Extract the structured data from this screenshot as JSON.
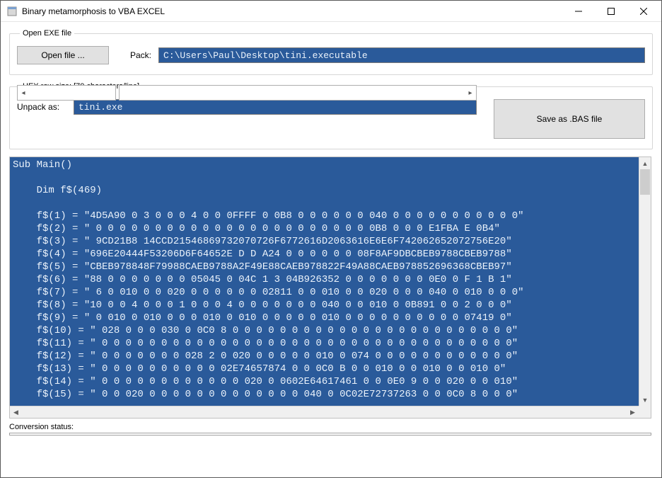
{
  "window": {
    "title": "Binary metamorphosis to VBA EXCEL"
  },
  "open_group": {
    "legend": "Open EXE file",
    "open_button": "Open file ...",
    "pack_label": "Pack:",
    "pack_value": "C:\\Users\\Paul\\Desktop\\tini.executable"
  },
  "hex_group": {
    "legend": "HEX row size: [70 characters/line]",
    "unpack_label": "Unpack as:",
    "unpack_value": "tini.exe",
    "save_button": "Save as .BAS file"
  },
  "code_lines": [
    "Sub Main()",
    "",
    "    Dim f$(469)",
    "",
    "    f$(1) = \"4D5A90 0 3 0 0 0 4 0 0 0FFFF 0 0B8 0 0 0 0 0 0 040 0 0 0 0 0 0 0 0 0 0 0\"",
    "    f$(2) = \" 0 0 0 0 0 0 0 0 0 0 0 0 0 0 0 0 0 0 0 0 0 0 0 0B8 0 0 0 E1FBA E 0B4\"",
    "    f$(3) = \" 9CD21B8 14CCD21546869732070726F6772616D2063616E6E6F742062652072756E20\"",
    "    f$(4) = \"696E20444F53206D6F64652E D D A24 0 0 0 0 0 0 08F8AF9DBCBEB9788CBEB9788\"",
    "    f$(5) = \"CBEB978848F79988CAEB9788A2F49E88CAEB978822F49A88CAEB978852696368CBEB97\"",
    "    f$(6) = \"88 0 0 0 0 0 0 0 05045 0 04C 1 3 04B926352 0 0 0 0 0 0 0 0E0 0 F 1 B 1\"",
    "    f$(7) = \" 6 0 010 0 0 020 0 0 0 0 0 0 02811 0 0 010 0 0 020 0 0 0 040 0 010 0 0 0\"",
    "    f$(8) = \"10 0 0 4 0 0 0 1 0 0 0 4 0 0 0 0 0 0 0 040 0 0 010 0 0B891 0 0 2 0 0 0\"",
    "    f$(9) = \" 0 010 0 010 0 0 0 010 0 010 0 0 0 0 0 010 0 0 0 0 0 0 0 0 0 0 07419 0\"",
    "    f$(10) = \" 028 0 0 0 030 0 0C0 8 0 0 0 0 0 0 0 0 0 0 0 0 0 0 0 0 0 0 0 0 0 0 0 0\"",
    "    f$(11) = \" 0 0 0 0 0 0 0 0 0 0 0 0 0 0 0 0 0 0 0 0 0 0 0 0 0 0 0 0 0 0 0 0 0 0 0\"",
    "    f$(12) = \" 0 0 0 0 0 0 0 028 2 0 020 0 0 0 0 0 010 0 074 0 0 0 0 0 0 0 0 0 0 0 0\"",
    "    f$(13) = \" 0 0 0 0 0 0 0 0 0 0 02E74657874 0 0 0C0 B 0 0 010 0 0 010 0 0 010 0\"",
    "    f$(14) = \" 0 0 0 0 0 0 0 0 0 0 0 0 020 0 0602E64617461 0 0 0E0 9 0 0 020 0 0 010\"",
    "    f$(15) = \" 0 0 020 0 0 0 0 0 0 0 0 0 0 0 0 0 040 0 0C02E72737263 0 0 0C0 8 0 0 0\""
  ],
  "status": {
    "label": "Conversion status:"
  }
}
